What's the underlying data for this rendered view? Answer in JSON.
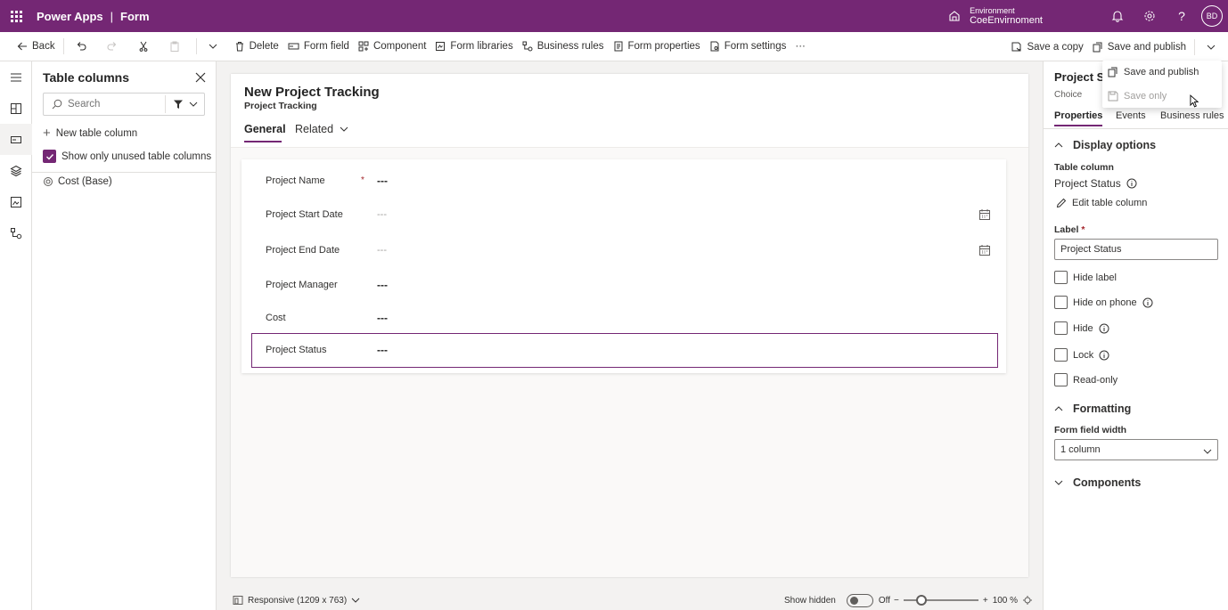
{
  "header": {
    "app_name": "Power Apps",
    "separator": "|",
    "page_name": "Form",
    "environment_label": "Environment",
    "environment_name": "CoeEnvirnoment",
    "avatar_initials": "BD",
    "brand_color": "#742774"
  },
  "commandbar": {
    "back": "Back",
    "delete": "Delete",
    "form_field": "Form field",
    "component": "Component",
    "form_libraries": "Form libraries",
    "business_rules": "Business rules",
    "form_properties": "Form properties",
    "form_settings": "Form settings",
    "more": "···",
    "save_a_copy": "Save a copy",
    "save_and_publish": "Save and publish"
  },
  "save_menu": {
    "items": [
      {
        "label": "Save and publish",
        "disabled": false
      },
      {
        "label": "Save only",
        "disabled": true
      }
    ]
  },
  "table_columns": {
    "title": "Table columns",
    "search_placeholder": "Search",
    "new_column": "New table column",
    "show_unused": "Show only unused table columns",
    "show_unused_checked": true,
    "columns": [
      "Cost (Base)"
    ]
  },
  "form": {
    "title": "New Project Tracking",
    "subtitle": "Project Tracking",
    "tabs": [
      "General",
      "Related"
    ],
    "fields": [
      {
        "label": "Project Name",
        "required": "*",
        "value": "---",
        "light": false,
        "calendar": false
      },
      {
        "label": "Project Start Date",
        "required": "",
        "value": "---",
        "light": true,
        "calendar": true
      },
      {
        "label": "Project End Date",
        "required": "",
        "value": "---",
        "light": true,
        "calendar": true
      },
      {
        "label": "Project Manager",
        "required": "",
        "value": "---",
        "light": false,
        "calendar": false
      },
      {
        "label": "Cost",
        "required": "",
        "value": "---",
        "light": false,
        "calendar": false
      },
      {
        "label": "Project Status",
        "required": "",
        "value": "---",
        "light": false,
        "calendar": false,
        "selected": true
      }
    ]
  },
  "statusbar": {
    "responsive": "Responsive (1209 x 763)",
    "show_hidden": "Show hidden",
    "toggle_state": "Off",
    "zoom_minus": "−",
    "zoom_plus": "+",
    "zoom_level": "100 %"
  },
  "properties": {
    "title": "Project Status",
    "type": "Choice",
    "tabs": [
      "Properties",
      "Events",
      "Business rules"
    ],
    "display_options": "Display options",
    "table_column_label": "Table column",
    "table_column_value": "Project Status",
    "edit_table_column": "Edit table column",
    "label_label": "Label",
    "label_required": "*",
    "label_value": "Project Status",
    "checkboxes": [
      {
        "label": "Hide label",
        "info": false
      },
      {
        "label": "Hide on phone",
        "info": true
      },
      {
        "label": "Hide",
        "info": true
      },
      {
        "label": "Lock",
        "info": true
      },
      {
        "label": "Read-only",
        "info": false
      }
    ],
    "formatting": "Formatting",
    "form_field_width_label": "Form field width",
    "form_field_width_value": "1 column",
    "components": "Components"
  }
}
